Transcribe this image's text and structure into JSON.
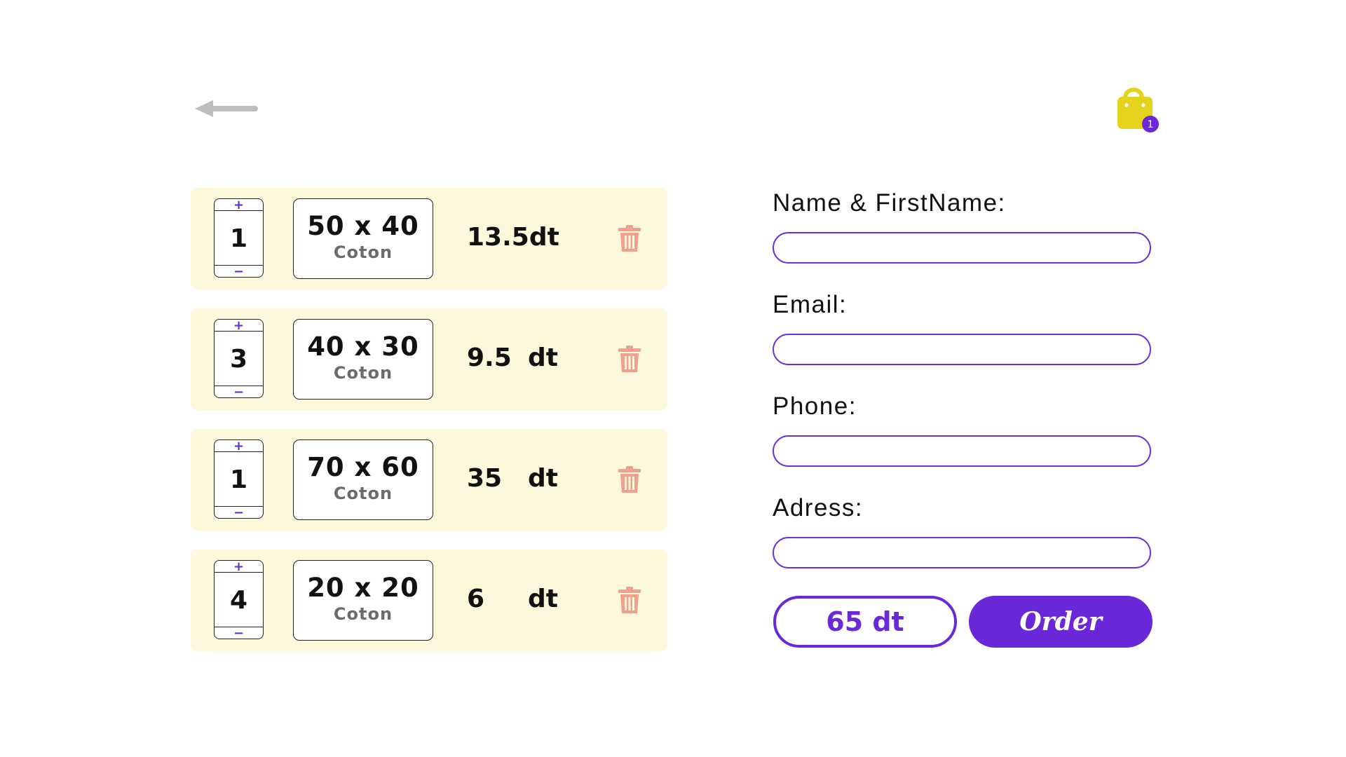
{
  "header": {
    "back_icon": "arrow-left-icon",
    "cart_icon": "shopping-bag-icon",
    "cart_count": "1",
    "colors": {
      "back": "#bdbdbd",
      "bag": "#e5d21c",
      "badge": "#6a28d9"
    }
  },
  "cart": {
    "increment_label": "+",
    "decrement_label": "−",
    "items": [
      {
        "quantity": "1",
        "size": "50 x 40",
        "material": "Coton",
        "price": "13.5",
        "currency": "dt"
      },
      {
        "quantity": "3",
        "size": "40 x 30",
        "material": "Coton",
        "price": "9.5",
        "currency": "dt"
      },
      {
        "quantity": "1",
        "size": "70 x 60",
        "material": "Coton",
        "price": "35",
        "currency": "dt"
      },
      {
        "quantity": "4",
        "size": "20 x 20",
        "material": "Coton",
        "price": "6",
        "currency": "dt"
      }
    ],
    "colors": {
      "row_bg": "#fbf8dc",
      "trash": "#f0a08c"
    }
  },
  "form": {
    "name_label": "Name & FirstName:",
    "email_label": "Email:",
    "phone_label": "Phone:",
    "address_label": "Adress:",
    "name_value": "",
    "email_value": "",
    "phone_value": "",
    "address_value": ""
  },
  "footer": {
    "total": "65 dt",
    "order_label": "Order",
    "colors": {
      "accent": "#6a28d9"
    }
  }
}
